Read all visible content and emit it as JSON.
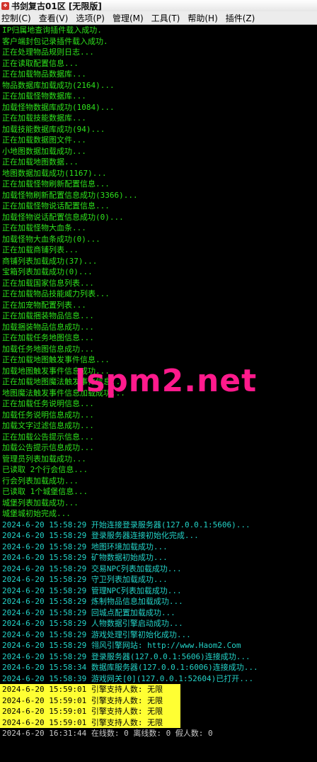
{
  "window": {
    "icon": "app-icon",
    "title": "书剑复古01区 [无限版]"
  },
  "menu": [
    "控制(C)",
    "查看(V)",
    "选项(P)",
    "管理(M)",
    "工具(T)",
    "帮助(H)",
    "插件(Z)"
  ],
  "watermark": "lspm2.net",
  "log_lines": [
    {
      "text": "IP归属地查询插件载入成功.",
      "color": "green"
    },
    {
      "text": "客户端封包记录插件载入成功.",
      "color": "green"
    },
    {
      "text": "正在处理物品规则日志...",
      "color": "green"
    },
    {
      "text": "正在读取配置信息...",
      "color": "green"
    },
    {
      "text": "正在加载物品数据库...",
      "color": "green"
    },
    {
      "text": "物品数据库加载成功(2164)...",
      "color": "green"
    },
    {
      "text": "正在加载怪物数据库...",
      "color": "green"
    },
    {
      "text": "加载怪物数据库成功(1084)...",
      "color": "green"
    },
    {
      "text": "正在加载技能数据库...",
      "color": "green"
    },
    {
      "text": "加载技能数据库成功(94)...",
      "color": "green"
    },
    {
      "text": "正在加载数据图文件...",
      "color": "green"
    },
    {
      "text": "小地图数据加载成功...",
      "color": "green"
    },
    {
      "text": "正在加载地图数据...",
      "color": "green"
    },
    {
      "text": "地图数据加载成功(1167)...",
      "color": "green"
    },
    {
      "text": "正在加载怪物刷新配置信息...",
      "color": "green"
    },
    {
      "text": "加载怪物刷新配置信息成功(3366)...",
      "color": "green"
    },
    {
      "text": "正在加载怪物说话配置信息...",
      "color": "green"
    },
    {
      "text": "加载怪物说话配置信息成功(0)...",
      "color": "green"
    },
    {
      "text": "正在加载怪物大血条...",
      "color": "green"
    },
    {
      "text": "加载怪物大血条成功(0)...",
      "color": "green"
    },
    {
      "text": "正在加载商铺列表...",
      "color": "green"
    },
    {
      "text": "商铺列表加载成功(37)...",
      "color": "green"
    },
    {
      "text": "宝箱列表加载成功(0)...",
      "color": "green"
    },
    {
      "text": "正在加载国家信息列表...",
      "color": "green"
    },
    {
      "text": "正在加载物品技能威力列表...",
      "color": "green"
    },
    {
      "text": "正在加宠物配置列表...",
      "color": "green"
    },
    {
      "text": "正在加载捆装物品信息...",
      "color": "green"
    },
    {
      "text": "加载捆装物品信息成功...",
      "color": "green"
    },
    {
      "text": "正在加载任务地图信息...",
      "color": "green"
    },
    {
      "text": "加载任务地图信息成功...",
      "color": "green"
    },
    {
      "text": "正在加载地图触发事件信息...",
      "color": "green"
    },
    {
      "text": "加载地图触发事件信息成功...",
      "color": "green"
    },
    {
      "text": "正在加载地图魔法触发事件信息...",
      "color": "green"
    },
    {
      "text": "地图魔法触发事件信息加载成功...",
      "color": "green"
    },
    {
      "text": "正在加载任务说明信息...",
      "color": "green"
    },
    {
      "text": "加载任务说明信息成功...",
      "color": "green"
    },
    {
      "text": "加载文字过滤信息成功...",
      "color": "green"
    },
    {
      "text": "正在加载公告提示信息...",
      "color": "green"
    },
    {
      "text": "加载公告提示信息成功...",
      "color": "green"
    },
    {
      "text": "管理员列表加载成功...",
      "color": "green"
    },
    {
      "text": "已读取 2个行会信息...",
      "color": "green"
    },
    {
      "text": "行会列表加载成功...",
      "color": "green"
    },
    {
      "text": "已读取 1个城堡信息...",
      "color": "green"
    },
    {
      "text": "城堡列表加载成功...",
      "color": "green"
    },
    {
      "text": "城堡城初始完成...",
      "color": "green"
    },
    {
      "text": "2024-6-20 15:58:29 开始连接登录服务器(127.0.0.1:5606)...",
      "color": "cyan"
    },
    {
      "text": "2024-6-20 15:58:29 登录服务器连接初始化完成...",
      "color": "cyan"
    },
    {
      "text": "2024-6-20 15:58:29 地图环境加载成功...",
      "color": "cyan"
    },
    {
      "text": "2024-6-20 15:58:29 矿物数据初始成功...",
      "color": "cyan"
    },
    {
      "text": "2024-6-20 15:58:29 交易NPC列表加载成功...",
      "color": "cyan"
    },
    {
      "text": "2024-6-20 15:58:29 守卫列表加载成功...",
      "color": "cyan"
    },
    {
      "text": "2024-6-20 15:58:29 管理NPC列表加载成功...",
      "color": "cyan"
    },
    {
      "text": "2024-6-20 15:58:29 炼制物品信息加载成功...",
      "color": "cyan"
    },
    {
      "text": "2024-6-20 15:58:29 回城点配置加载成功...",
      "color": "cyan"
    },
    {
      "text": "2024-6-20 15:58:29 人物数据引擎启动成功...",
      "color": "cyan"
    },
    {
      "text": "2024-6-20 15:58:29 游戏处理引擎初始化成功...",
      "color": "cyan"
    },
    {
      "text": "2024-6-20 15:58:29 翎风引擎网站: http://www.Haom2.Com",
      "color": "cyan"
    },
    {
      "text": "2024-6-20 15:58:29 登录服务器(127.0.0.1:5606)连接成功...",
      "color": "cyan"
    },
    {
      "text": "2024-6-20 15:58:34 数据库服务器(127.0.0.1:6006)连接成功...",
      "color": "cyan"
    },
    {
      "text": "2024-6-20 15:58:39 游戏网关[0](127.0.0.1:52604)已打开...",
      "color": "cyan"
    },
    {
      "text": "2024-6-20 15:59:01 引擎支持人数: 无限",
      "color": "yellow"
    },
    {
      "text": "2024-6-20 15:59:01 引擎支持人数: 无限",
      "color": "yellow"
    },
    {
      "text": "2024-6-20 15:59:01 引擎支持人数: 无限",
      "color": "yellow"
    },
    {
      "text": "2024-6-20 15:59:01 引擎支持人数: 无限",
      "color": "yellow"
    },
    {
      "text": "2024-6-20 16:31:44 在线数: 0 离线数: 0 假人数: 0",
      "color": "gray"
    }
  ]
}
